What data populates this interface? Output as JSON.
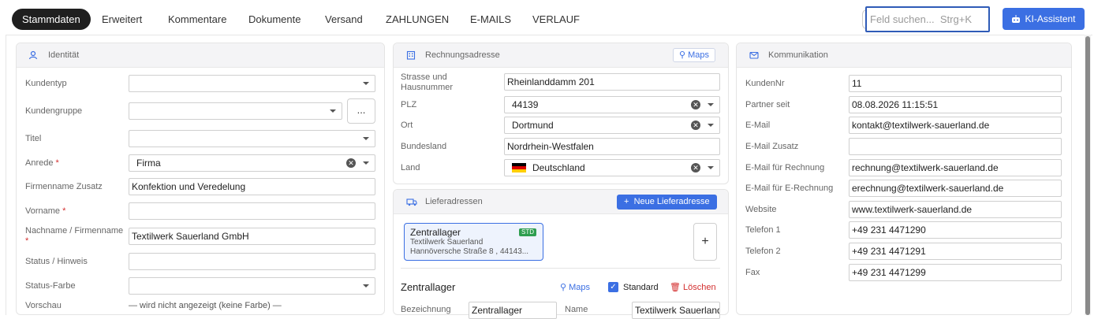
{
  "tabs": [
    {
      "label": "Stammdaten",
      "active": true
    },
    {
      "label": "Erweitert"
    },
    {
      "label": "Kommentare"
    },
    {
      "label": "Dokumente"
    },
    {
      "label": "Versand"
    },
    {
      "label": "ZAHLUNGEN"
    },
    {
      "label": "E-MAILS"
    },
    {
      "label": "VERLAUF"
    }
  ],
  "search": {
    "placeholder": "Feld suchen...  Strg+K"
  },
  "ki_button": {
    "label": "KI-Assistent"
  },
  "identitaet": {
    "title": "Identität",
    "kundentyp": {
      "label": "Kundentyp",
      "value": ""
    },
    "kundengruppe": {
      "label": "Kundengruppe",
      "value": "",
      "button": "..."
    },
    "titel": {
      "label": "Titel",
      "value": ""
    },
    "anrede": {
      "label": "Anrede",
      "value": "Firma"
    },
    "firmenname_zusatz": {
      "label": "Firmenname Zusatz",
      "value": "Konfektion und Veredelung"
    },
    "vorname": {
      "label": "Vorname",
      "value": ""
    },
    "nachname": {
      "label": "Nachname / Firmenname",
      "value": "Textilwerk Sauerland GmbH"
    },
    "status_hinweis": {
      "label": "Status / Hinweis",
      "value": ""
    },
    "status_farbe": {
      "label": "Status-Farbe",
      "value": ""
    },
    "vorschau": {
      "label": "Vorschau",
      "value": "— wird nicht angezeigt (keine Farbe) —"
    },
    "required_mark": "*"
  },
  "rechnungsadresse": {
    "title": "Rechnungsadresse",
    "maps": "Maps",
    "strasse": {
      "label1": "Strasse und",
      "label2": "Hausnummer",
      "value": "Rheinlanddamm 201"
    },
    "plz": {
      "label": "PLZ",
      "value": "44139"
    },
    "ort": {
      "label": "Ort",
      "value": "Dortmund"
    },
    "bundesland": {
      "label": "Bundesland",
      "value": "Nordrhein-Westfalen"
    },
    "land": {
      "label": "Land",
      "value": "Deutschland"
    }
  },
  "lieferadressen": {
    "title": "Lieferadressen",
    "new_button": "Neue Lieferadresse",
    "card": {
      "name": "Zentrallager",
      "badge": "STD",
      "line1": "Textilwerk Sauerland",
      "line2": "Hannöversche Straße 8 ,  44143..."
    },
    "add": "+",
    "detail": {
      "title": "Zentrallager",
      "maps": "Maps",
      "standard": "Standard",
      "loeschen": "Löschen",
      "bezeichnung": {
        "label": "Bezeichnung",
        "value": "Zentrallager"
      },
      "name": {
        "label": "Name",
        "value": "Textilwerk Sauerland"
      }
    }
  },
  "kommunikation": {
    "title": "Kommunikation",
    "kundennr": {
      "label": "KundenNr",
      "value": "11"
    },
    "partner_seit": {
      "label": "Partner seit",
      "value": "08.08.2026 11:15:51"
    },
    "email": {
      "label": "E-Mail",
      "value": "kontakt@textilwerk-sauerland.de"
    },
    "email_zusatz": {
      "label": "E-Mail Zusatz",
      "value": ""
    },
    "email_rechnung": {
      "label": "E-Mail für Rechnung",
      "value": "rechnung@textilwerk-sauerland.de"
    },
    "email_erechnung": {
      "label": "E-Mail für E-Rechnung",
      "value": "erechnung@textilwerk-sauerland.de"
    },
    "website": {
      "label": "Website",
      "value": "www.textilwerk-sauerland.de"
    },
    "telefon1": {
      "label": "Telefon 1",
      "value": "+49 231 4471290"
    },
    "telefon2": {
      "label": "Telefon 2",
      "value": "+49 231 4471291"
    },
    "fax": {
      "label": "Fax",
      "value": "+49 231 4471299"
    }
  },
  "colors": {
    "accent": "#3b6fe3",
    "active_tab": "#1f1f1f",
    "required": "#d32f2f",
    "badge_green": "#2e9e4f"
  },
  "icons": [
    "user-icon",
    "building-icon",
    "mail-icon",
    "truck-icon",
    "map-pin-icon",
    "trash-icon",
    "robot-icon",
    "plus-icon"
  ]
}
